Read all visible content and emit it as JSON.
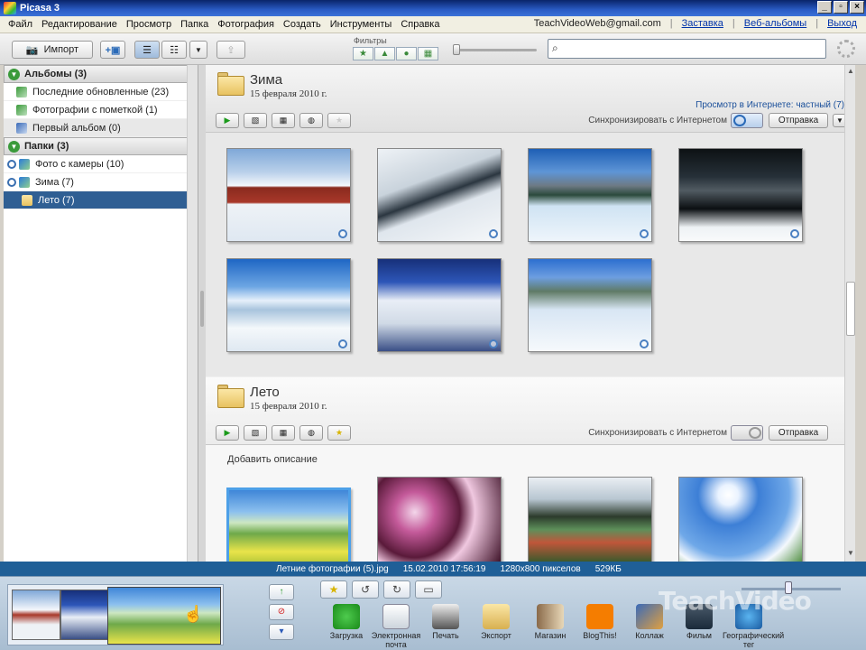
{
  "window": {
    "title": "Picasa 3"
  },
  "menu": {
    "items": [
      "Файл",
      "Редактирование",
      "Просмотр",
      "Папка",
      "Фотография",
      "Создать",
      "Инструменты",
      "Справка"
    ],
    "account": "TeachVideoWeb@gmail.com",
    "links": [
      "Заставка",
      "Веб-альбомы",
      "Выход"
    ]
  },
  "toolbar": {
    "import_label": "Импорт",
    "filters_label": "Фильтры"
  },
  "sidebar": {
    "albums_header": "Альбомы (3)",
    "albums": [
      "Последние обновленные (23)",
      "Фотографии с пометкой (1)",
      "Первый альбом (0)"
    ],
    "folders_header": "Папки (3)",
    "folders": [
      "Фото с камеры (10)",
      "Зима (7)",
      "Лето (7)"
    ]
  },
  "albums": [
    {
      "title": "Зима",
      "date": "15 февраля 2010 г.",
      "online_link": "Просмотр в Интернете: частный (7)",
      "sync_label": "Синхронизировать с Интернетом",
      "send_label": "Отправка"
    },
    {
      "title": "Лето",
      "date": "15 февраля 2010 г.",
      "sync_label": "Синхронизировать с Интернетом",
      "send_label": "Отправка",
      "description": "Добавить описание"
    }
  ],
  "info": {
    "filename": "Летние фотографии (5).jpg",
    "datetime": "15.02.2010 17:56:19",
    "resolution": "1280x800 пикселов",
    "size": "529КБ"
  },
  "actions": [
    {
      "label": "Загрузка",
      "icon": "upload-icon"
    },
    {
      "label": "Электронная почта",
      "icon": "email-icon"
    },
    {
      "label": "Печать",
      "icon": "print-icon"
    },
    {
      "label": "Экспорт",
      "icon": "export-icon"
    },
    {
      "label": "Магазин",
      "icon": "shop-icon"
    },
    {
      "label": "BlogThis!",
      "icon": "blogger-icon"
    },
    {
      "label": "Коллаж",
      "icon": "collage-icon"
    },
    {
      "label": "Фильм",
      "icon": "movie-icon"
    },
    {
      "label": "Географический тег",
      "icon": "geotag-icon"
    }
  ],
  "brand": {
    "name": "TeachVideo"
  }
}
